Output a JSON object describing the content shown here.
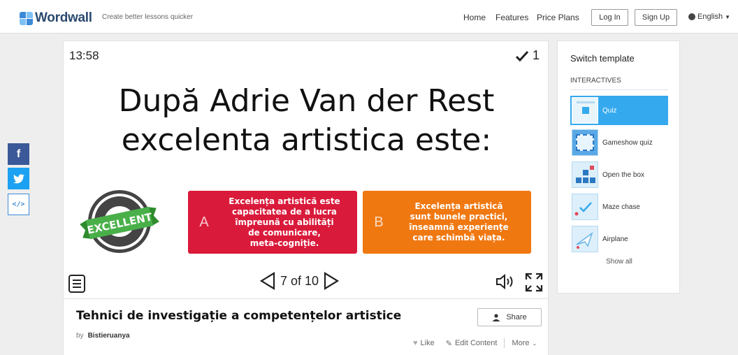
{
  "header": {
    "logo_text": "Wordwall",
    "tagline": "Create better lessons quicker",
    "nav": [
      "Home",
      "Features",
      "Price Plans"
    ],
    "login": "Log In",
    "signup": "Sign Up",
    "language": "English"
  },
  "social": {
    "facebook": "f",
    "twitter": "t",
    "embed": "</>"
  },
  "game": {
    "timer": "13:58",
    "score": "1",
    "question_lines": [
      "După Adrie Van der Rest",
      "excelenta artistica este:"
    ],
    "image_text": "EXCELLENT",
    "answers": [
      {
        "letter": "A",
        "lines": [
          "Excelența artistică este",
          "capacitatea de a lucra",
          "împreună cu abilități",
          "de comunicare,",
          "meta-cogniție."
        ],
        "color": "#d91a3a"
      },
      {
        "letter": "B",
        "lines": [
          "Excelența artistică",
          "sunt bunele practici,",
          "înseamnă experiențe",
          "care schimbă viața."
        ],
        "color": "#f07811"
      }
    ],
    "page_label": "7 of 10"
  },
  "activity": {
    "title": "Tehnici de investigație a competențelor artistice",
    "by_label": "by",
    "author": "Bistieruanya",
    "share": "Share",
    "like": "Like",
    "edit": "Edit Content",
    "more": "More"
  },
  "sidebar": {
    "title": "Switch template",
    "category": "INTERACTIVES",
    "templates": [
      {
        "name": "Quiz",
        "icon": "quiz-thumb-icon",
        "selected": true
      },
      {
        "name": "Gameshow quiz",
        "icon": "gameshow-quiz-thumb-icon",
        "selected": false
      },
      {
        "name": "Open the box",
        "icon": "open-the-box-thumb-icon",
        "selected": false
      },
      {
        "name": "Maze chase",
        "icon": "maze-chase-thumb-icon",
        "selected": false
      },
      {
        "name": "Airplane",
        "icon": "airplane-thumb-icon",
        "selected": false
      }
    ],
    "show_all": "Show all"
  },
  "colors": {
    "accent": "#35a9ee",
    "answer_a": "#d91a3a",
    "answer_b": "#f07811",
    "facebook": "#3b5998",
    "twitter": "#1da1f2"
  }
}
